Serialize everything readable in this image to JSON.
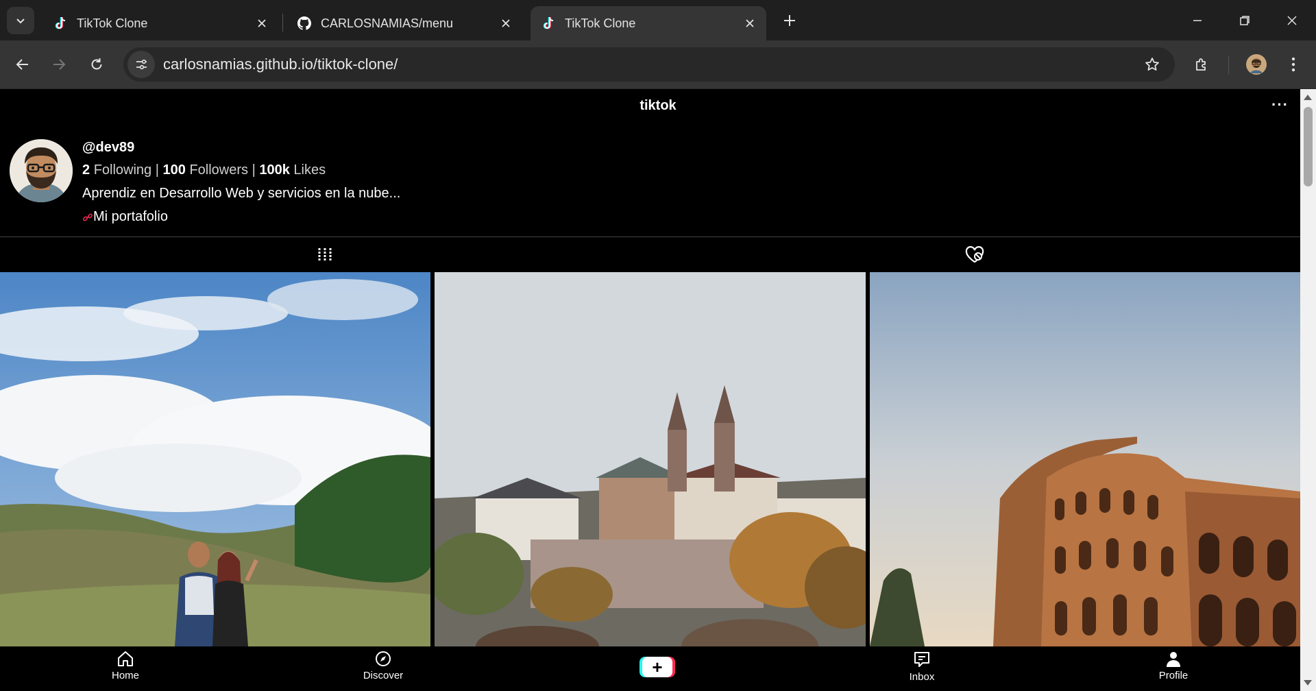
{
  "browser": {
    "tabs": [
      {
        "title": "TikTok Clone",
        "icon": "tiktok-icon",
        "active": false
      },
      {
        "title": "CARLOSNAMIAS/menu",
        "icon": "github-icon",
        "active": false
      },
      {
        "title": "TikTok Clone",
        "icon": "tiktok-icon",
        "active": true
      }
    ],
    "url": "carlosnamias.github.io/tiktok-clone/"
  },
  "app": {
    "brand": "tiktok",
    "more_label": "···",
    "profile": {
      "username": "@dev89",
      "following_count": "2",
      "following_label": "Following",
      "followers_count": "100",
      "followers_label": "Followers",
      "likes_count": "100k",
      "likes_label": "Likes",
      "separator": "|",
      "bio": "Aprendiz en Desarrollo Web y servicios en la nube...",
      "portfolio_label": "Mi portafolio"
    },
    "profile_tabs": [
      {
        "icon": "videos-grid-icon"
      },
      {
        "icon": "liked-heart-icon"
      }
    ],
    "thumbnails": [
      {
        "icon": "landscape-couple-photo"
      },
      {
        "icon": "cathedral-photo"
      },
      {
        "icon": "colosseum-photo"
      }
    ],
    "bottom_nav": {
      "home": "Home",
      "discover": "Discover",
      "create": "+",
      "inbox": "Inbox",
      "profile": "Profile"
    },
    "colors": {
      "accent_cyan": "#25f4ee",
      "accent_red": "#fe2c55",
      "background": "#000000"
    }
  }
}
